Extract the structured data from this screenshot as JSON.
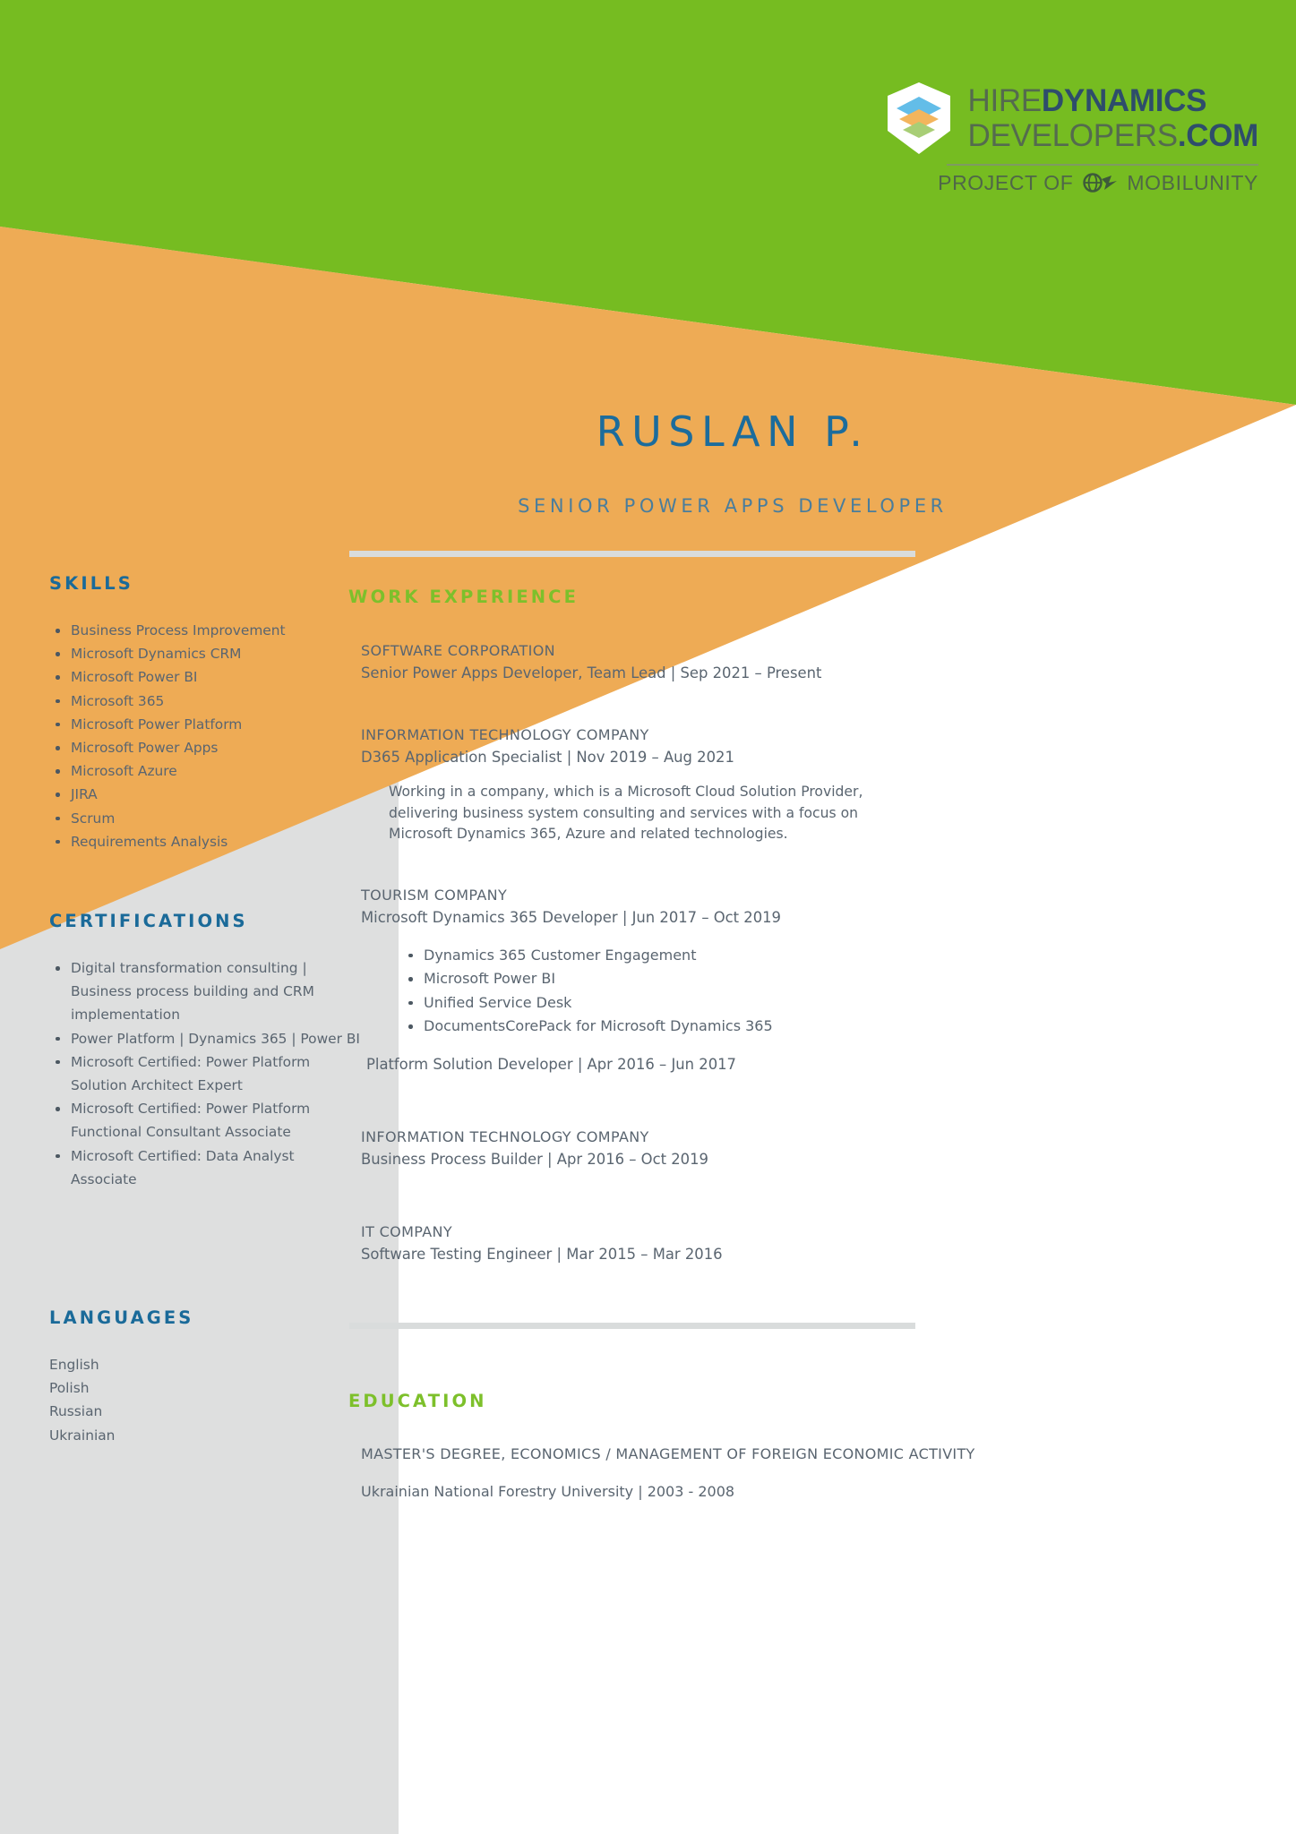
{
  "colors": {
    "green": "#76bc21",
    "orange": "#eeab55",
    "gray": "#dedfdf",
    "blue_heading": "#1a6a99",
    "name_blue": "#1c6c9c",
    "role_blue": "#4a7d9c",
    "green_heading": "#7dc02b",
    "body_text": "#5a6570",
    "divider": "#d9dcdc"
  },
  "logo": {
    "icon": "layered-cube-icon",
    "line1_light": "HIRE",
    "line1_bold": "DYNAMICS",
    "line2_light": "DEVELOPERS",
    "line2_bold": ".COM",
    "tagline_prefix": "PROJECT OF",
    "tagline_icon": "mobilunity-globe-icon",
    "tagline_brand": "MOBILUNITY"
  },
  "header": {
    "name": "RUSLAN P.",
    "role": "SENIOR POWER APPS DEVELOPER"
  },
  "sidebar": {
    "skills": {
      "heading": "SKILLS",
      "items": [
        "Business Process Improvement",
        "Microsoft Dynamics CRM",
        "Microsoft Power BI",
        "Microsoft 365",
        "Microsoft Power Platform",
        "Microsoft Power Apps",
        "Microsoft Azure",
        "JIRA",
        "Scrum",
        "Requirements Analysis"
      ]
    },
    "certifications": {
      "heading": "CERTIFICATIONS",
      "items": [
        "Digital transformation consulting | Business process building and CRM implementation",
        "Power Platform | Dynamics 365 | Power BI",
        "Microsoft Certified: Power Platform Solution Architect Expert",
        "Microsoft Certified: Power Platform Functional Consultant Associate",
        "Microsoft Certified: Data Analyst Associate"
      ]
    },
    "languages": {
      "heading": "LANGUAGES",
      "items": [
        "English",
        "Polish",
        "Russian",
        "Ukrainian"
      ]
    }
  },
  "main": {
    "work": {
      "heading": "WORK EXPERIENCE",
      "jobs": [
        {
          "company": "SOFTWARE CORPORATION",
          "position": "Senior Power Apps Developer, Team Lead | Sep 2021 – Present"
        },
        {
          "company": "INFORMATION TECHNOLOGY COMPANY",
          "position": "D365 Application Specialist | Nov 2019 – Aug 2021",
          "description": "Working in a company, which is a Microsoft Cloud Solution Provider, delivering business system consulting and services with a focus on Microsoft Dynamics 365, Azure and related technologies."
        },
        {
          "company": "TOURISM COMPANY",
          "position": "Microsoft Dynamics 365 Developer | Jun 2017 – Oct 2019",
          "bullets": [
            "Dynamics 365 Customer Engagement",
            "Microsoft Power BI",
            "Unified Service Desk",
            "DocumentsCorePack for Microsoft Dynamics 365"
          ],
          "sub_position": "Platform Solution Developer | Apr 2016 – Jun 2017"
        },
        {
          "company": "INFORMATION TECHNOLOGY COMPANY",
          "position": "Business Process Builder | Apr 2016 – Oct 2019"
        },
        {
          "company": "IT COMPANY",
          "position": "Software Testing Engineer | Mar 2015 – Mar 2016"
        }
      ]
    },
    "education": {
      "heading": "EDUCATION",
      "degree": "MASTER'S DEGREE, ECONOMICS / MANAGEMENT OF FOREIGN ECONOMIC ACTIVITY",
      "school": "Ukrainian National Forestry University | 2003 - 2008"
    }
  }
}
